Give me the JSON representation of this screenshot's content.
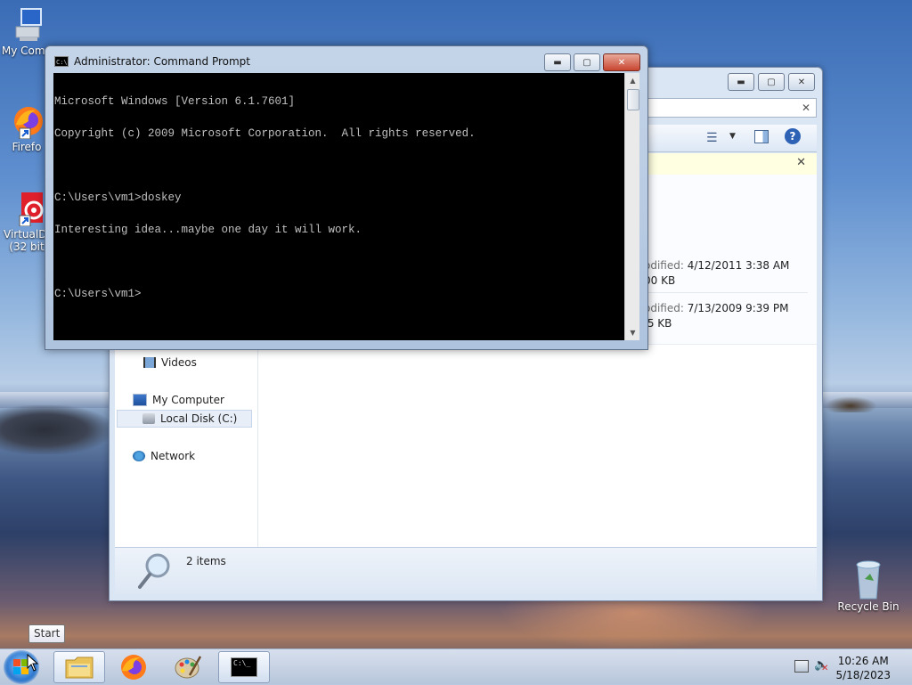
{
  "desktop": {
    "icons": [
      {
        "label": "My Comp"
      },
      {
        "label": "Firefo"
      },
      {
        "label": "VirtualDJ\n(32 bit"
      },
      {
        "label": "Recycle Bin"
      }
    ]
  },
  "explorer": {
    "search_value": "",
    "nav": {
      "videos": "Videos",
      "my_computer": "My Computer",
      "local_disk": "Local Disk (C:)",
      "network": "Network"
    },
    "files": [
      {
        "modified_label": "odified:",
        "modified": "4/12/2011 3:38 AM",
        "size": "00 KB"
      },
      {
        "modified_label": "odified:",
        "modified": "7/13/2009 9:39 PM",
        "size": ".5 KB"
      }
    ],
    "status": "2 items"
  },
  "cmd": {
    "title": "Administrator: Command Prompt",
    "lines": [
      "Microsoft Windows [Version 6.1.7601]",
      "Copyright (c) 2009 Microsoft Corporation.  All rights reserved.",
      "",
      "C:\\Users\\vm1>doskey",
      "Interesting idea...maybe one day it will work.",
      "",
      "C:\\Users\\vm1>"
    ]
  },
  "tooltip": "Start",
  "taskbar": {
    "time": "10:26 AM",
    "date": "5/18/2023"
  }
}
